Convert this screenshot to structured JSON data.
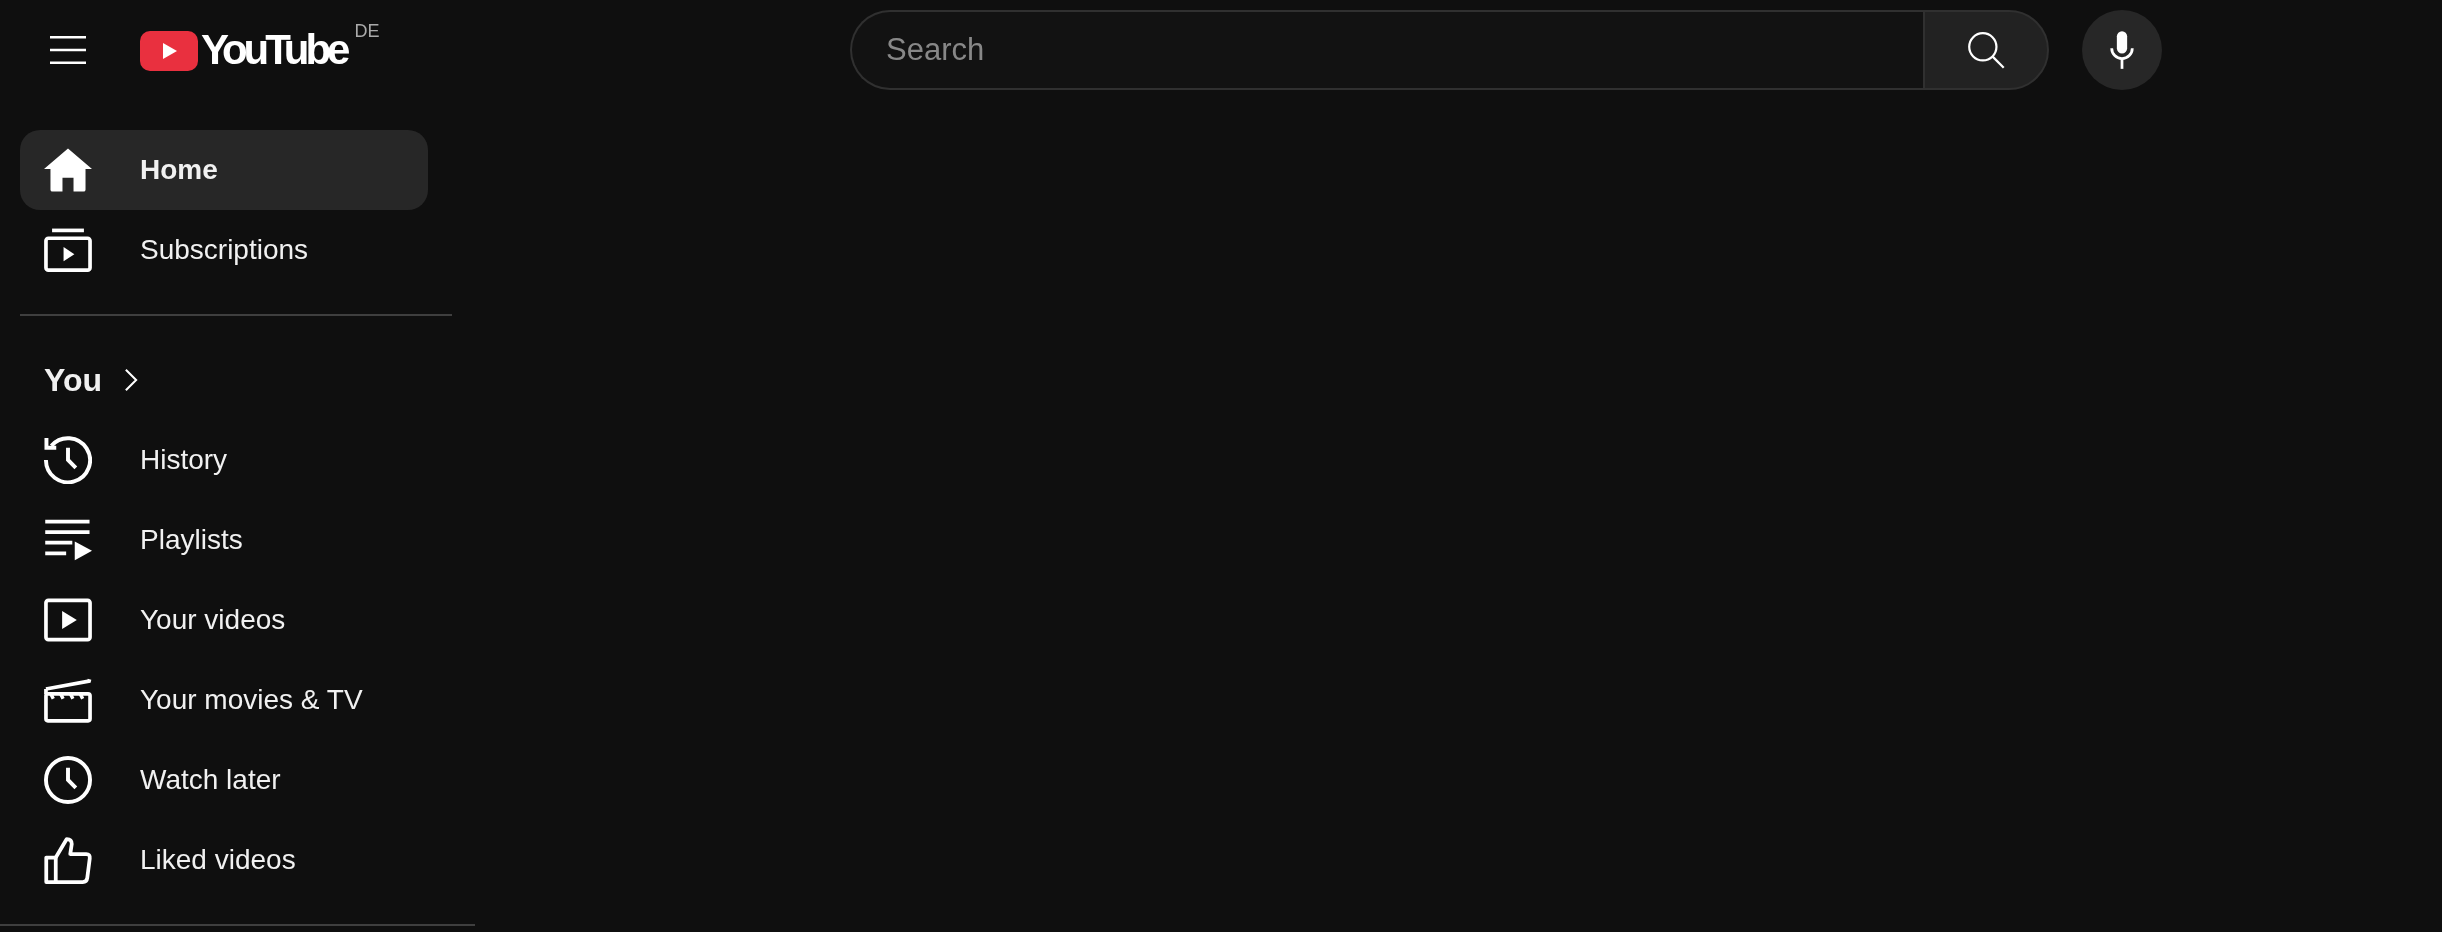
{
  "header": {
    "logo": {
      "wordmark": "YouTube",
      "country_code": "DE"
    },
    "search": {
      "placeholder": "Search"
    }
  },
  "sidebar": {
    "sections": [
      {
        "items": [
          {
            "label": "Home",
            "selected": true
          },
          {
            "label": "Subscriptions",
            "selected": false
          }
        ]
      },
      {
        "heading": "You",
        "items": [
          {
            "label": "History",
            "selected": false
          },
          {
            "label": "Playlists",
            "selected": false
          },
          {
            "label": "Your videos",
            "selected": false
          },
          {
            "label": "Your movies & TV",
            "selected": false
          },
          {
            "label": "Watch later",
            "selected": false
          },
          {
            "label": "Liked videos",
            "selected": false
          }
        ]
      }
    ]
  }
}
